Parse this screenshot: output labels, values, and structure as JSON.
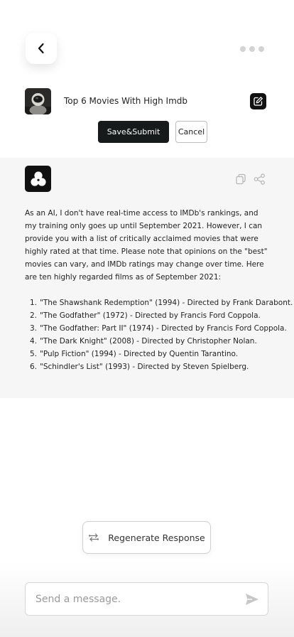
{
  "header": {
    "back_icon": "chevron-left-icon",
    "more_icon": "more-horizontal-icon"
  },
  "prompt": {
    "text": "Top 6 Movies With High Imdb",
    "edit_icon": "edit-icon"
  },
  "actions": {
    "save_label": "Save&Submit",
    "cancel_label": "Cancel"
  },
  "response": {
    "intro": "As an AI, I don't have real-time access to IMDb's rankings, and my training only goes up until September 2021. However, I can provide you with a list of critically acclaimed movies that were highly rated at that time. Please note that opinions on the \"best\" movies can vary, and IMDb ratings may change over time. Here are ten highly regarded films as of September 2021:",
    "items": [
      {
        "num": "1.",
        "text": "\"The Shawshank Redemption\" (1994) - Directed by Frank Darabont."
      },
      {
        "num": "2.",
        "text": "\"The Godfather\" (1972) - Directed by Francis Ford Coppola."
      },
      {
        "num": "3.",
        "text": "\"The Godfather: Part II\" (1974) - Directed by Francis Ford Coppola."
      },
      {
        "num": "4.",
        "text": "\"The Dark Knight\" (2008) - Directed by Christopher Nolan."
      },
      {
        "num": "5.",
        "text": "\"Pulp Fiction\" (1994) - Directed by Quentin Tarantino."
      },
      {
        "num": "6.",
        "text": "\"Schindler's List\" (1993) - Directed by Steven Spielberg."
      }
    ]
  },
  "regenerate": {
    "label": "Regenerate Response"
  },
  "composer": {
    "placeholder": "Send a message."
  },
  "colors": {
    "primary_dark": "#161a1a",
    "response_bg": "#f6f6f6"
  }
}
